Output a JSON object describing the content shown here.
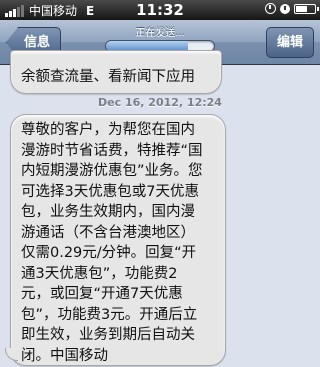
{
  "status_bar": {
    "carrier": "中国移动",
    "network": "E",
    "time": "11:32"
  },
  "nav_bar": {
    "back_label": "信息",
    "edit_label": "编辑",
    "sending_label": "正在发送...",
    "send_progress": 0.76
  },
  "messages": {
    "previous_text": "余额查流量、看新闻下应用",
    "timestamp": "Dec 16, 2012, 12:24",
    "current_text": "尊敬的客户，为帮您在国内\n漫游时节省话费，特推荐“国\n内短期漫游优惠包”业务。您\n可选择3天优惠包或7天优惠\n包，业务生效期内，国内漫\n游通话（不含台港澳地区）\n仅需0.29元/分钟。回复“开\n通3天优惠包”，功能费2\n元，或回复“开通7天优惠\n包”，功能费3元。开通后立\n即生效，业务到期后自动关\n闭。中国移动"
  },
  "icons": {
    "signal": "signal-bars-icon",
    "lock": "rotation-lock-icon",
    "alarm": "alarm-icon",
    "battery": "battery-icon"
  }
}
